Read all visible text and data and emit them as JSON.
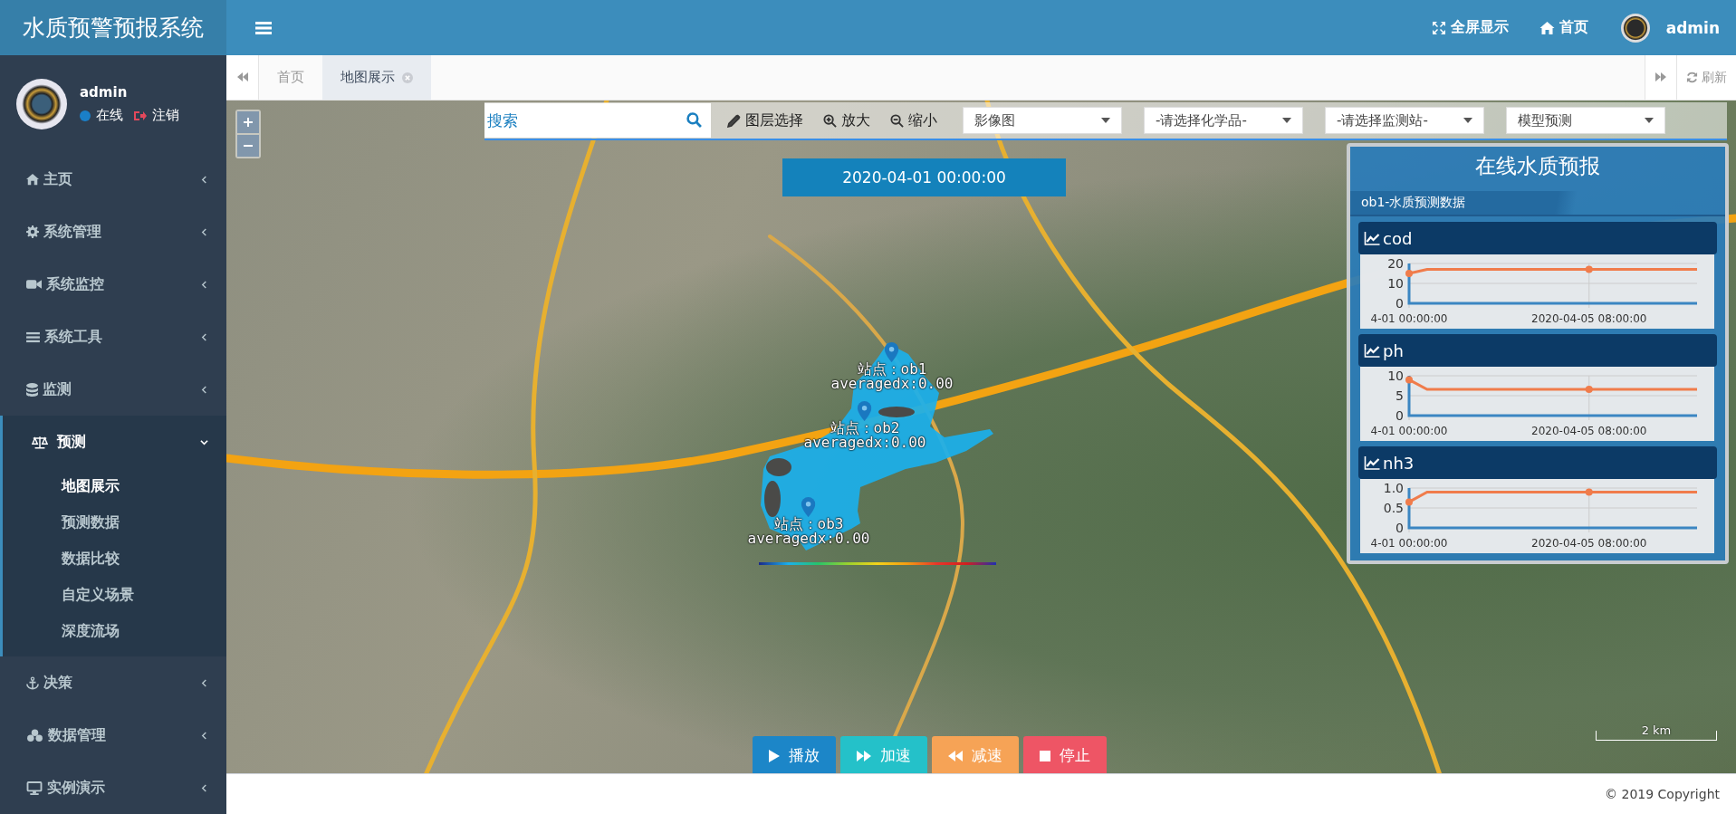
{
  "header": {
    "title": "水质预警预报系统",
    "actions": [
      {
        "label": "全屏显示"
      },
      {
        "label": "首页"
      }
    ],
    "user": "admin"
  },
  "sidebar": {
    "user": {
      "name": "admin",
      "status": "在线",
      "logout": "注销"
    },
    "items": [
      {
        "label": "主页",
        "expanded": false
      },
      {
        "label": "系统管理",
        "expanded": false
      },
      {
        "label": "系统监控",
        "expanded": false
      },
      {
        "label": "系统工具",
        "expanded": false
      },
      {
        "label": "监测",
        "expanded": false
      },
      {
        "label": "预测",
        "expanded": true,
        "children": [
          {
            "label": "地图展示",
            "selected": true
          },
          {
            "label": "预测数据",
            "selected": false
          },
          {
            "label": "数据比较",
            "selected": false
          },
          {
            "label": "自定义场景",
            "selected": false
          },
          {
            "label": "深度流场",
            "selected": false
          }
        ]
      },
      {
        "label": "决策",
        "expanded": false
      },
      {
        "label": "数据管理",
        "expanded": false
      },
      {
        "label": "实例演示",
        "expanded": false
      }
    ]
  },
  "tabs": [
    {
      "label": "首页",
      "selected": false,
      "closable": false
    },
    {
      "label": "地图展示",
      "selected": true,
      "closable": true
    }
  ],
  "refresh": "刷新",
  "map": {
    "search": {
      "placeholder": "搜索"
    },
    "tools": [
      "图层选择",
      "放大",
      "缩小"
    ],
    "selects": [
      "影像图",
      "-请选择化学品-",
      "-请选择监测站-",
      "模型预测"
    ],
    "time": "2020-04-01 00:00:00",
    "stations": [
      {
        "name": "站点：ob1",
        "value": "averagedx:0.00"
      },
      {
        "name": "站点：ob2",
        "value": "averagedx:0.00"
      },
      {
        "name": "站点：ob3",
        "value": "averagedx:0.00"
      }
    ],
    "scale": "2 km",
    "controls": [
      {
        "label": "播放",
        "kind": "play"
      },
      {
        "label": "加速",
        "kind": "faster"
      },
      {
        "label": "减速",
        "kind": "slower"
      },
      {
        "label": "停止",
        "kind": "stop"
      }
    ]
  },
  "panel": {
    "title": "在线水质预报",
    "subtitle": "ob1-水质预测数据",
    "charts": [
      {
        "chart_data": {
          "type": "line",
          "categories": [
            "4-01 00:00:00",
            null,
            null,
            null,
            null,
            null,
            null,
            null,
            null,
            null,
            "2020-04-05 08:00:00",
            null,
            null,
            null,
            null,
            null,
            null
          ],
          "ylim": [
            0,
            20
          ],
          "yticks": [
            0,
            10,
            20
          ],
          "series": [
            {
              "name": "cod",
              "color": "#f07c4b",
              "values": [
                15,
                17,
                17,
                17,
                17,
                17,
                17,
                17,
                17,
                17,
                17,
                17,
                17,
                17,
                17,
                17,
                17
              ]
            }
          ]
        }
      },
      {
        "chart_data": {
          "type": "line",
          "categories": [
            "4-01 00:00:00",
            null,
            null,
            null,
            null,
            null,
            null,
            null,
            null,
            null,
            "2020-04-05 08:00:00",
            null,
            null,
            null,
            null,
            null,
            null
          ],
          "ylim": [
            0,
            10
          ],
          "yticks": [
            0,
            5,
            10
          ],
          "series": [
            {
              "name": "ph",
              "color": "#f07c4b",
              "values": [
                9,
                6.6,
                6.6,
                6.6,
                6.6,
                6.6,
                6.6,
                6.6,
                6.6,
                6.6,
                6.6,
                6.6,
                6.6,
                6.6,
                6.6,
                6.6,
                6.6
              ]
            }
          ]
        }
      },
      {
        "chart_data": {
          "type": "line",
          "categories": [
            "4-01 00:00:00",
            null,
            null,
            null,
            null,
            null,
            null,
            null,
            null,
            null,
            "2020-04-05 08:00:00",
            null,
            null,
            null,
            null,
            null,
            null
          ],
          "ylim": [
            0,
            1
          ],
          "yticks": [
            {
              "value": 0,
              "label": "0"
            },
            {
              "value": 0.5,
              "label": "0.5"
            },
            {
              "value": 1,
              "label": "1.0"
            }
          ],
          "series": [
            {
              "name": "nh3",
              "color": "#f07c4b",
              "values": [
                0.65,
                0.9,
                0.9,
                0.9,
                0.9,
                0.9,
                0.9,
                0.9,
                0.9,
                0.9,
                0.9,
                0.9,
                0.9,
                0.9,
                0.9,
                0.9,
                0.9
              ]
            }
          ]
        }
      }
    ]
  },
  "footer": "© 2019 Copyright"
}
